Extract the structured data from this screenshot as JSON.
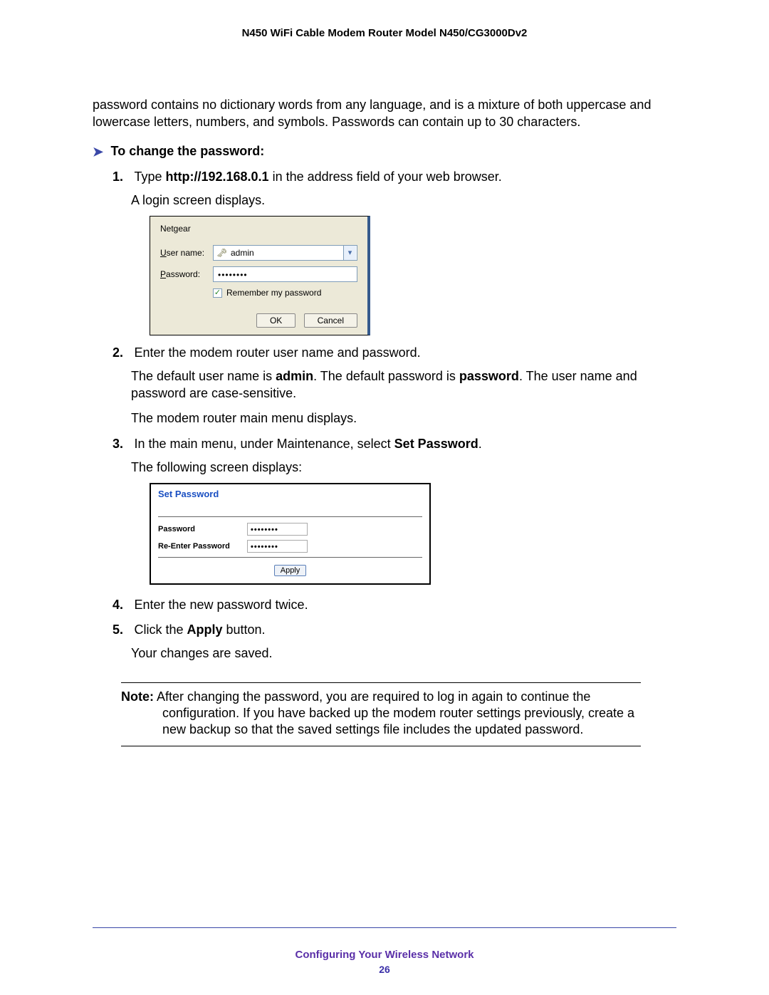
{
  "header": {
    "title": "N450 WiFi Cable Modem Router Model N450/CG3000Dv2"
  },
  "intro": "password contains no dictionary words from any language, and is a mixture of both uppercase and lowercase letters, numbers, and symbols. Passwords can contain up to 30 characters.",
  "procedure": {
    "title": "To change the password:",
    "steps": {
      "1": {
        "num": "1.",
        "pre": "Type ",
        "bold": "http://192.168.0.1",
        "post": " in the address field of your web browser.",
        "sub": "A login screen displays."
      },
      "2": {
        "num": "2.",
        "text": "Enter the modem router user name and password.",
        "subA_pre": "The default user name is ",
        "subA_b1": "admin",
        "subA_mid": ". The default password is ",
        "subA_b2": "password",
        "subA_post": ". The user name and password are case-sensitive.",
        "subB": "The modem router main menu displays."
      },
      "3": {
        "num": "3.",
        "pre": "In the main menu, under Maintenance, select ",
        "bold": "Set Password",
        "post": ".",
        "sub": "The following screen displays:"
      },
      "4": {
        "num": "4.",
        "text": "Enter the new password twice."
      },
      "5": {
        "num": "5.",
        "pre": "Click the ",
        "bold": "Apply",
        "post": " button.",
        "sub": "Your changes are saved."
      }
    }
  },
  "login_dialog": {
    "site": "Netgear",
    "username_label": "User name:",
    "username_value": "admin",
    "password_label": "Password:",
    "password_value": "••••••••",
    "remember_label": "Remember my password",
    "ok": "OK",
    "cancel": "Cancel"
  },
  "set_password_panel": {
    "title": "Set Password",
    "row1_label": "Password",
    "row1_value": "••••••••",
    "row2_label": "Re-Enter Password",
    "row2_value": "••••••••",
    "apply": "Apply"
  },
  "note": {
    "label": "Note:",
    "text": " After changing the password, you are required to log in again to continue the configuration. If you have backed up the modem router settings previously, create a new backup so that the saved settings file includes the updated password."
  },
  "footer": {
    "section": "Configuring Your Wireless Network",
    "page": "26"
  }
}
